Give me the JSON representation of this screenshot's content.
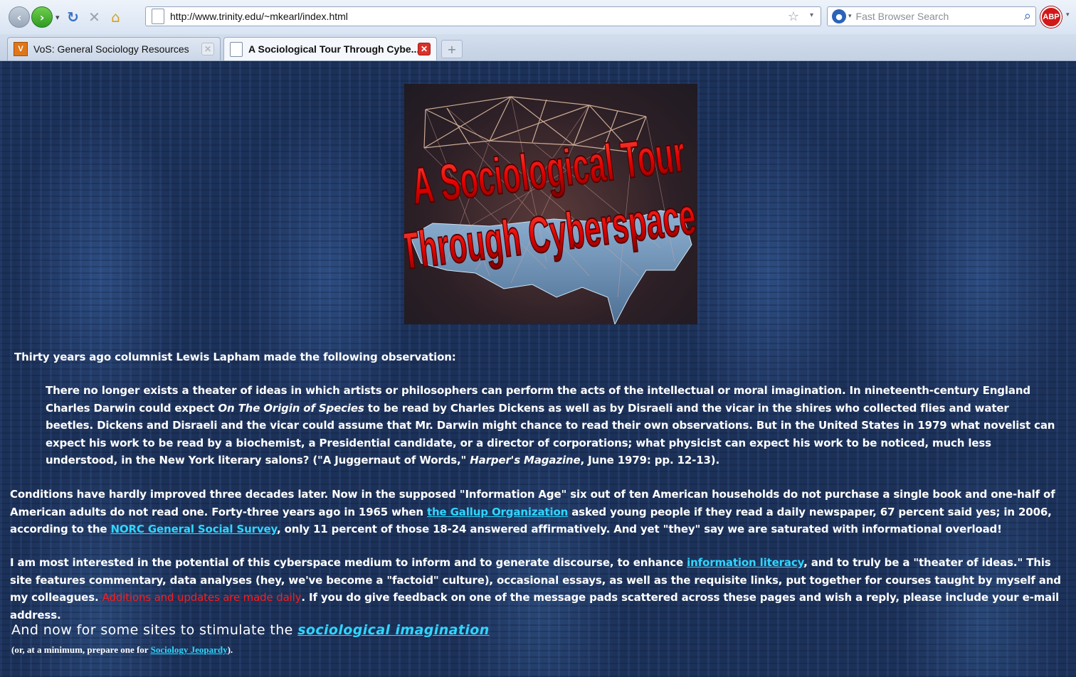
{
  "browser": {
    "url": "http://www.trinity.edu/~mkearl/index.html",
    "search_placeholder": "Fast Browser Search",
    "adblock_label": "ABP",
    "back_icon": "back-arrow-icon",
    "forward_icon": "forward-arrow-icon",
    "reload_icon": "reload-icon",
    "stop_icon": "stop-icon",
    "home_icon": "home-icon",
    "tabs": [
      {
        "label": "VoS: General Sociology Resources",
        "favicon": "V",
        "active": false
      },
      {
        "label": "A Sociological Tour Through Cybe...",
        "active": true
      }
    ],
    "new_tab_label": "+"
  },
  "banner": {
    "line1": "A Sociological Tour",
    "line2": "Through Cyberspace"
  },
  "page": {
    "intro": "Thirty years ago columnist Lewis Lapham made the following observation:",
    "quote": {
      "t1": "There no longer exists a theater of ideas in which artists or philosophers can perform the acts of the intellectual or moral imagination. In nineteenth-century England Charles Darwin could expect ",
      "book": "On The Origin of Species",
      "t2": " to be read by Charles Dickens as well as by Disraeli and the vicar in the shires who collected flies and water beetles. Dickens and Disraeli and the vicar could assume that Mr. Darwin might chance to read their own observations. But in the United States in 1979 what novelist can expect his work to be read by a biochemist, a Presidential candidate, or a director of corporations; what physicist can expect his work to be noticed, much less understood, in the New York literary salons? (\"A Juggernaut of Words,\" ",
      "magazine": "Harper's Magazine",
      "t3": ", June 1979: pp. 12-13)."
    },
    "para2": {
      "t1": "Conditions have hardly improved three decades later. Now in the supposed \"Information Age\" six out of ten American households do not purchase a single book and one-half of American adults do not read one. Forty-three years ago in  1965 when ",
      "link1": "the Gallup Organization",
      "t2": " asked young people if they read a daily newspaper, 67 percent said yes; in 2006, according to the ",
      "link2": "NORC General Social Survey",
      "t3": ", only 11 percent of those 18-24 answered affirmatively. And yet \"they\" say we are saturated with informational overload!"
    },
    "para3": {
      "t1": "I am most interested in the potential of this cyberspace medium to inform and to generate discourse, to enhance ",
      "link1": "information literacy",
      "t2": ", and to truly be a \"theater of ideas.\" This site features commentary, data analyses (hey, we've become a \"factoid\" culture), occasional essays, as well as the requisite links, put together for courses taught by myself and my colleagues.  ",
      "red": "Additions and updates are made daily",
      "t3": ".  If you do give feedback on one of the message pads scattered across these pages and wish a reply, please include your e-mail address."
    },
    "subhead": {
      "t1": "And now for some sites to stimulate the ",
      "link": "sociological imagination"
    },
    "note": {
      "t1": "(or, at a minimum, prepare one for ",
      "link": "Sociology Jeopardy",
      "t2": ")."
    }
  }
}
